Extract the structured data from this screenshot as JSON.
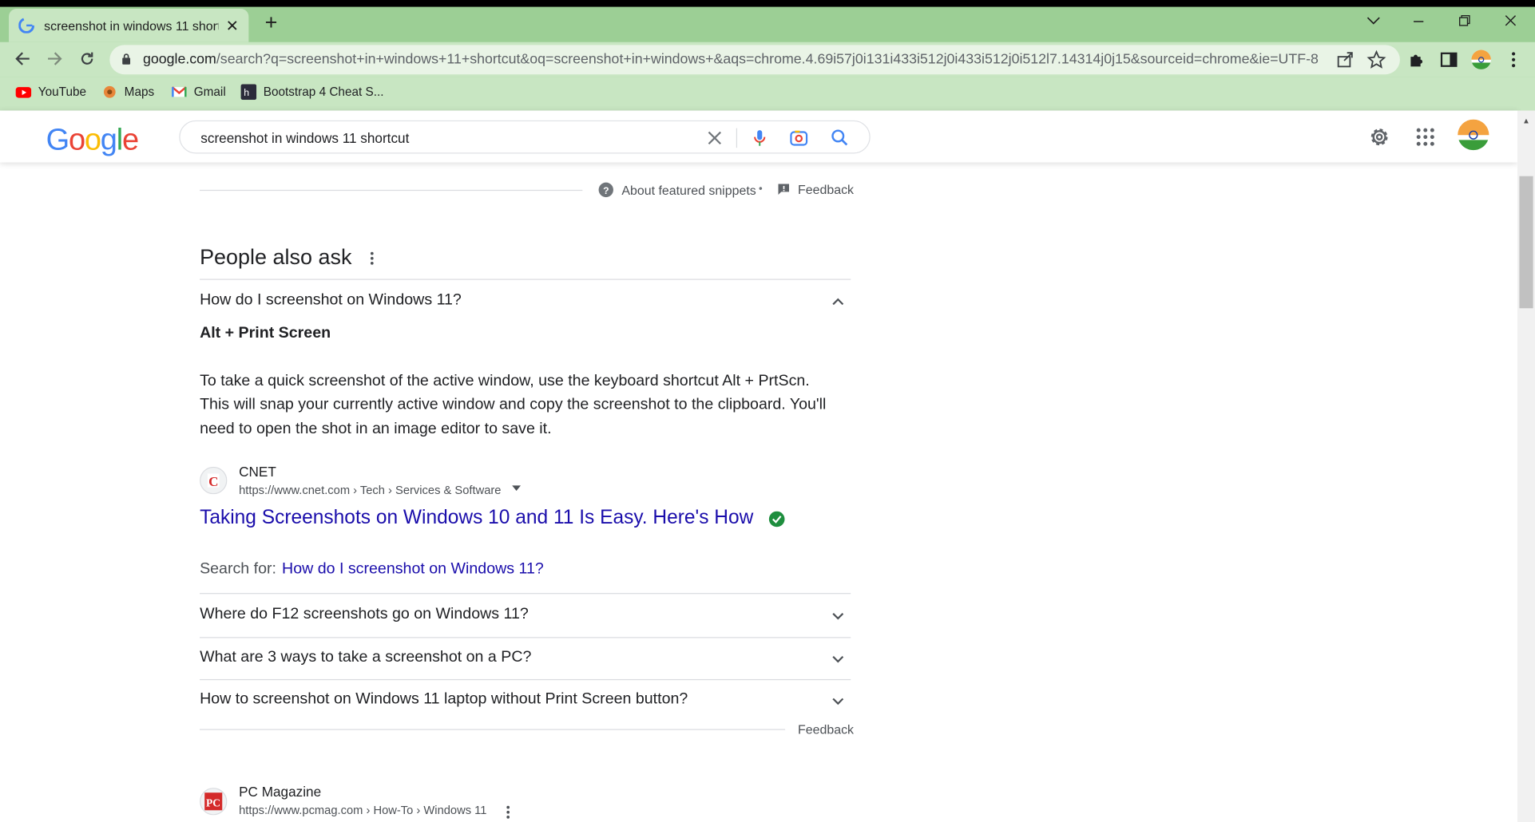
{
  "browser": {
    "tab_title": "screenshot in windows 11 shortcut",
    "url_host": "google.com",
    "url_path": "/search?q=screenshot+in+windows+11+shortcut&oq=screenshot+in+windows+&aqs=chrome.4.69i57j0i131i433i512j0i433i512j0i512l7.14314j0j15&sourceid=chrome&ie=UTF-8",
    "bookmarks": [
      {
        "label": "YouTube"
      },
      {
        "label": "Maps"
      },
      {
        "label": "Gmail"
      },
      {
        "label": "Bootstrap 4 Cheat S..."
      }
    ],
    "accent": "#9ccf95"
  },
  "google": {
    "logo": "Google",
    "query": "screenshot in windows 11 shortcut"
  },
  "snippet_footer": {
    "about": "About featured snippets",
    "bullet": "•",
    "feedback": "Feedback"
  },
  "paa": {
    "heading": "People also ask",
    "expanded": {
      "question": "How do I screenshot on Windows 11?",
      "answer_title": "Alt + Print Screen",
      "answer_line1": "To take a quick screenshot of the active window, use the keyboard shortcut Alt + PrtScn.",
      "answer_line2": "This will snap your currently active window and copy the screenshot to the clipboard. You'll",
      "answer_line3": "need to open the shot in an image editor to save it.",
      "source_name": "CNET",
      "source_url": "https://www.cnet.com › Tech › Services & Software",
      "result_title": "Taking Screenshots on Windows 10 and 11 Is Easy. Here's How",
      "search_for_label": "Search for:",
      "search_for_link": "How do I screenshot on Windows 11?"
    },
    "questions": [
      "Where do F12 screenshots go on Windows 11?",
      "What are 3 ways to take a screenshot on a PC?",
      "How to screenshot on Windows 11 laptop without Print Screen button?"
    ],
    "feedback": "Feedback"
  },
  "next_result": {
    "source_name": "PC Magazine",
    "source_url": "https://www.pcmag.com › How-To › Windows 11",
    "favicon_text": "PC"
  }
}
